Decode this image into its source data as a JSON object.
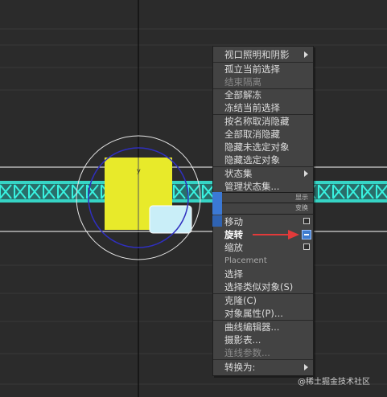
{
  "viewport": {
    "background": "#2b2b2b",
    "grid_color": "#3a3a3a",
    "object_color": "#e8ea2a",
    "highlight_color": "#38f2e0"
  },
  "menu": {
    "top_section": [
      {
        "label": "视口照明和阴影",
        "submenu": true,
        "disabled": false
      },
      {
        "label": "孤立当前选择",
        "disabled": false
      },
      {
        "label": "结束隔离",
        "disabled": true
      },
      {
        "label": "全部解冻",
        "disabled": false
      },
      {
        "label": "冻结当前选择",
        "disabled": false
      },
      {
        "label": "按名称取消隐藏",
        "disabled": false
      },
      {
        "label": "全部取消隐藏",
        "disabled": false
      },
      {
        "label": "隐藏未选定对象",
        "disabled": false
      },
      {
        "label": "隐藏选定对象",
        "disabled": false
      },
      {
        "label": "状态集",
        "submenu": true,
        "disabled": false
      },
      {
        "label": "管理状态集...",
        "disabled": false
      }
    ],
    "quad_labels": {
      "display": "显示",
      "transform": "变换"
    },
    "bottom_section": [
      {
        "label": "移动",
        "icon": "square-icon"
      },
      {
        "label": "旋转",
        "icon": "rotate-settings-icon",
        "selected": true
      },
      {
        "label": "缩放",
        "icon": "square-icon"
      },
      {
        "label": "Placement"
      },
      {
        "label": "选择"
      },
      {
        "label": "选择类似对象(S)"
      },
      {
        "label": "克隆(C)"
      },
      {
        "label": "对象属性(P)..."
      },
      {
        "label": "曲线编辑器..."
      },
      {
        "label": "摄影表..."
      },
      {
        "label": "连线参数...",
        "disabled": true
      },
      {
        "label": "转换为:",
        "submenu": true
      }
    ]
  },
  "annotation": {
    "arrow_color": "#e23a3a"
  },
  "watermark": "@稀土掘金技术社区"
}
